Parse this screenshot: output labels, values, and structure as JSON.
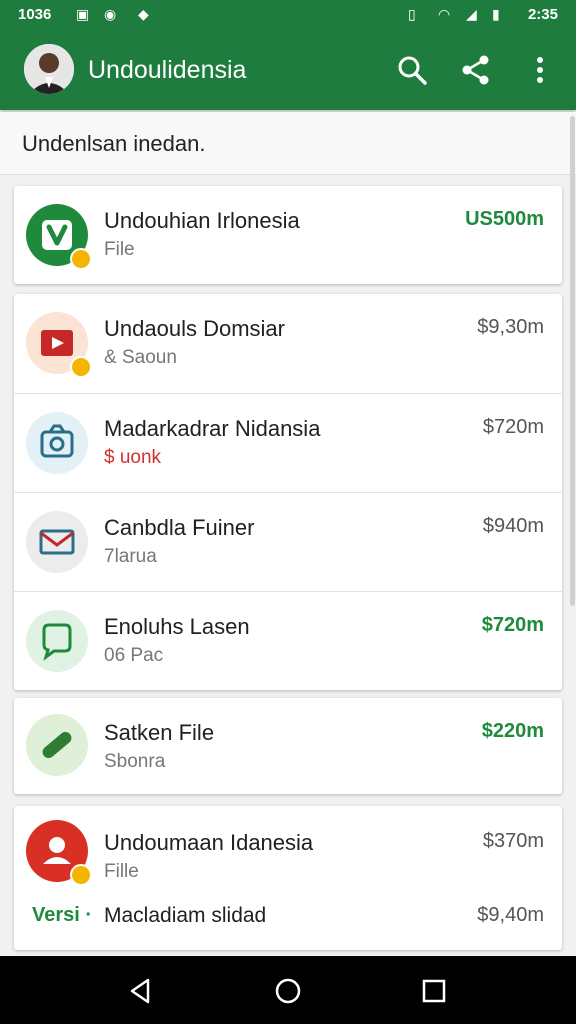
{
  "status": {
    "time": "1036",
    "time_right": "2:35"
  },
  "appbar": {
    "title": "Undoulidensia"
  },
  "subheader": {
    "text": "Undenlsan inedan."
  },
  "items": [
    {
      "title": "Undouhian Irlonesia",
      "subtitle": "File",
      "price": "US500m",
      "price_green": true,
      "icon": "vine-icon"
    },
    {
      "title": "Undaouls Domsiar",
      "subtitle": "& Saoun",
      "price": "$9,30m",
      "price_green": false,
      "icon": "video-icon"
    },
    {
      "title": "Madarkadrar Nidansia",
      "subtitle": "$ uonk",
      "price": "$720m",
      "price_green": false,
      "icon": "camera-icon"
    },
    {
      "title": "Canbdla Fuiner",
      "subtitle": "7larua",
      "price": "$940m",
      "price_green": false,
      "icon": "mail-icon"
    },
    {
      "title": "Enoluhs Lasen",
      "subtitle": "06 Pac",
      "price": "$720m",
      "price_green": true,
      "icon": "chat-icon"
    },
    {
      "title": "Satken File",
      "subtitle": "Sbonra",
      "price": "$220m",
      "price_green": true,
      "icon": "pill-icon"
    },
    {
      "title": "Undoumaan Idanesia",
      "subtitle": "Fille",
      "price": "$370m",
      "price_green": false,
      "icon": "person-icon"
    }
  ],
  "footer_row": {
    "tag": "Versi ·",
    "title": "Macladiam slidad",
    "price": "$9,40m"
  },
  "colors": {
    "primary": "#1e7d3e",
    "accent_green": "#1f8a3c"
  }
}
